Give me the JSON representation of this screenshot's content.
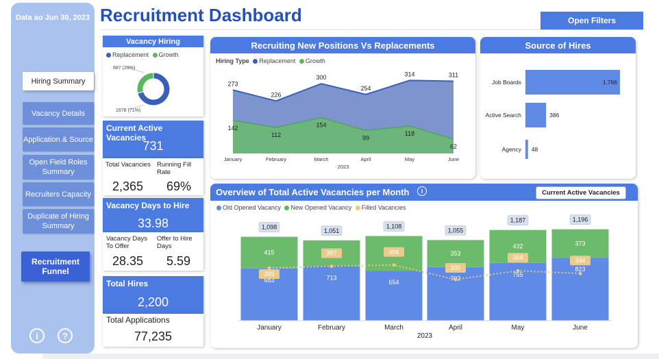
{
  "sidebar": {
    "date": "Data ao Jun 30, 2023",
    "items": [
      {
        "label": "Hiring Summary"
      },
      {
        "label": "Vacancy Details"
      },
      {
        "label": "Application & Source"
      },
      {
        "label": "Open Field Roles Summary"
      },
      {
        "label": "Recruiters Capacity"
      },
      {
        "label": "Duplicate of Hiring Summary"
      }
    ],
    "funnel_label": "Recruitment Funnel",
    "info_icon": "i",
    "help_icon": "?"
  },
  "header": {
    "title": "Recruitment Dashboard",
    "filters_button": "Open Filters"
  },
  "colors": {
    "accent": "#4b7ae0",
    "replacement": "#3a5fb8",
    "growth": "#5cb85c",
    "filled": "#f2c77a"
  },
  "vacancy_hiring": {
    "title": "Vacancy Hiring",
    "legend": [
      "Replacement",
      "Growth"
    ],
    "growth_label": "687 (29%)",
    "replacement_label": "1678 (71%)",
    "chart_data": {
      "type": "pie",
      "labels": [
        "Replacement",
        "Growth"
      ],
      "values": [
        1678,
        687
      ]
    }
  },
  "kpis": {
    "current_active": {
      "label": "Current Active Vacancies",
      "value": "731"
    },
    "total_vacancies": {
      "label": "Total Vacancies",
      "value": "2,365"
    },
    "running_fill_rate": {
      "label": "Running Fill Rate",
      "value": "69%"
    },
    "vacancy_days_to_hire": {
      "label": "Vacancy Days to Hire",
      "value": "33.98"
    },
    "vacancy_days_to_offer": {
      "label": "Vacancy Days To Offer",
      "value": "28.35"
    },
    "offer_to_hire_days": {
      "label": "Offer to Hire Days",
      "value": "5.59"
    },
    "total_hires": {
      "label": "Total Hires",
      "value": "2,200"
    },
    "total_applications": {
      "label": "Total Applications",
      "value": "77,235"
    }
  },
  "new_vs_replacement": {
    "title": "Recruiting New Positions Vs Replacements",
    "legend_title": "Hiring Type",
    "legend": [
      "Replacement",
      "Growth"
    ],
    "chart_data": {
      "type": "area",
      "categories": [
        "January",
        "February",
        "March",
        "April",
        "May",
        "June"
      ],
      "series": [
        {
          "name": "Replacement",
          "values": [
            273,
            226,
            300,
            254,
            314,
            311
          ]
        },
        {
          "name": "Growth",
          "values": [
            142,
            112,
            154,
            99,
            118,
            62
          ]
        }
      ],
      "xlabel": "2023",
      "ylim": [
        0,
        330
      ]
    }
  },
  "source_of_hires": {
    "title": "Source of Hires",
    "chart_data": {
      "type": "bar",
      "categories": [
        "Job Boards",
        "Active Search",
        "Agency"
      ],
      "values": [
        1766,
        386,
        48
      ],
      "value_labels": [
        "1,766",
        "386",
        "48"
      ]
    }
  },
  "monthly_overview": {
    "title": "Overview of Total Active Vacancies per Month",
    "info_icon": "i",
    "button": "Current Active Vacancies",
    "legend": [
      "Old Opened Vacancy",
      "New Opened Vacancy",
      "Filled Vacancies"
    ],
    "chart_data": {
      "type": "bar",
      "categories": [
        "January",
        "February",
        "March",
        "April",
        "May",
        "June"
      ],
      "xlabel": "2023",
      "series": [
        {
          "name": "Old Opened Vacancy",
          "values": [
            683,
            713,
            654,
            702,
            755,
            823
          ]
        },
        {
          "name": "New Opened Vacancy",
          "values": [
            415,
            338,
            454,
            353,
            432,
            373
          ]
        },
        {
          "name": "Filled Vacancies",
          "values": [
            385,
            397,
            406,
            300,
            364,
            344
          ]
        }
      ],
      "totals": [
        "1,098",
        "1,051",
        "1,108",
        "1,055",
        "1,187",
        "1,196"
      ],
      "ylim": [
        0,
        1300
      ]
    }
  }
}
